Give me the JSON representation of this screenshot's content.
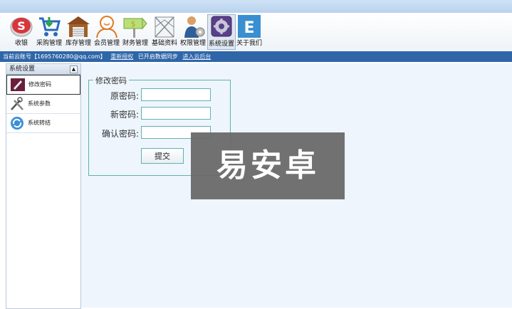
{
  "toolbar": {
    "items": [
      {
        "label": "收银",
        "icon": "cashier-icon"
      },
      {
        "label": "采购管理",
        "icon": "shopping-cart-icon"
      },
      {
        "label": "库存管理",
        "icon": "warehouse-icon"
      },
      {
        "label": "会员管理",
        "icon": "member-icon"
      },
      {
        "label": "财务管理",
        "icon": "finance-icon"
      },
      {
        "label": "基础资料",
        "icon": "basic-data-icon"
      },
      {
        "label": "权限管理",
        "icon": "permission-icon"
      },
      {
        "label": "系统设置",
        "icon": "system-settings-icon"
      },
      {
        "label": "关于我们",
        "icon": "about-icon"
      }
    ],
    "active_index": 7
  },
  "infobar": {
    "account_text": "当前云账号【1695760280@qq.com】",
    "reauth_link": "重新授权",
    "sync_status": "已开启数据同步",
    "cloud_link": "进入云后台"
  },
  "sidebar": {
    "title": "系统设置",
    "items": [
      {
        "label": "修改密码",
        "icon": "edit-password-icon"
      },
      {
        "label": "系统参数",
        "icon": "tools-icon"
      },
      {
        "label": "系统转结",
        "icon": "recycle-icon"
      }
    ]
  },
  "form": {
    "legend": "修改密码",
    "old_label": "原密码:",
    "new_label": "新密码:",
    "confirm_label": "确认密码:",
    "old_value": "",
    "new_value": "",
    "confirm_value": "",
    "submit_label": "提交"
  },
  "watermark": "易安卓",
  "colors": {
    "infobar": "#2f66a8",
    "main_background": "#eef5fd",
    "form_border": "#5fb3ad"
  }
}
